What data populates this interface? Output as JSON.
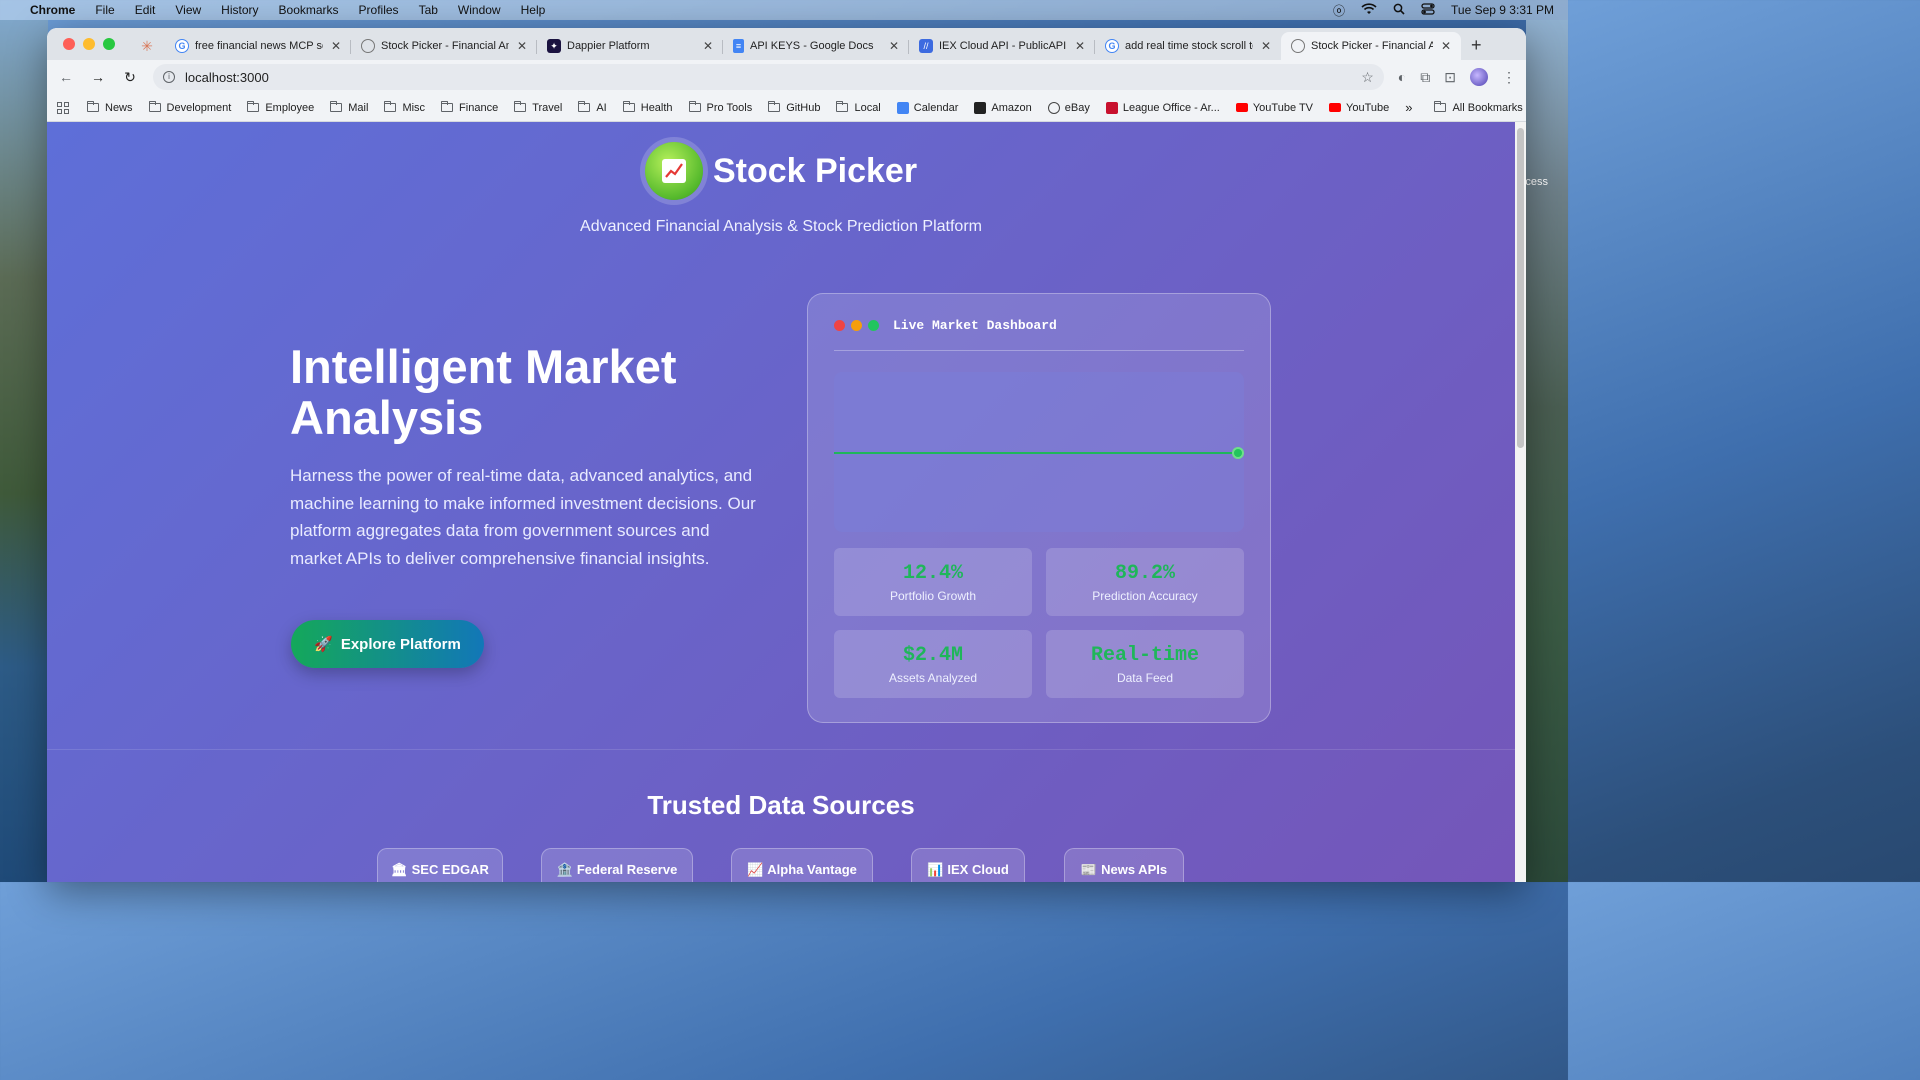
{
  "menubar": {
    "app": "Chrome",
    "items": [
      "File",
      "Edit",
      "View",
      "History",
      "Bookmarks",
      "Profiles",
      "Tab",
      "Window",
      "Help"
    ],
    "clock": "Tue Sep 9  3:31 PM"
  },
  "tabs": [
    {
      "title": "free financial news MCP ser",
      "favicon": "google-icon"
    },
    {
      "title": "Stock Picker - Financial Ana",
      "favicon": "globe-icon"
    },
    {
      "title": "Dappier Platform",
      "favicon": "dappier-icon"
    },
    {
      "title": "API KEYS - Google Docs",
      "favicon": "docs-icon"
    },
    {
      "title": "IEX Cloud API - PublicAPI",
      "favicon": "publicapi-icon"
    },
    {
      "title": "add real time stock scroll to",
      "favicon": "google-icon"
    },
    {
      "title": "Stock Picker - Financial Ana",
      "favicon": "globe-icon",
      "active": true
    }
  ],
  "address": {
    "url": "localhost:3000"
  },
  "bookmarks": {
    "items": [
      "News",
      "Development",
      "Employee",
      "Mail",
      "Misc",
      "Finance",
      "Travel",
      "AI",
      "Health",
      "Pro Tools",
      "GitHub",
      "Local"
    ],
    "special": [
      "Calendar",
      "Amazon",
      "eBay",
      "League Office - Ar...",
      "YouTube TV",
      "YouTube"
    ],
    "overflow": "»",
    "all": "All Bookmarks"
  },
  "brand": {
    "name": "Stock Picker",
    "subtitle": "Advanced Financial Analysis & Stock Prediction Platform",
    "logo_icon": "chart-emoji-icon"
  },
  "hero": {
    "heading": "Intelligent Market Analysis",
    "body": "Harness the power of real-time data, advanced analytics, and machine learning to make informed investment decisions. Our platform aggregates data from government sources and market APIs to deliver comprehensive financial insights.",
    "cta_icon": "🚀",
    "cta_label": "Explore Platform"
  },
  "dashboard": {
    "title": "Live Market Dashboard",
    "dot_colors": [
      "#ef4444",
      "#f59e0b",
      "#22c55e"
    ],
    "stats": [
      {
        "value": "12.4%",
        "label": "Portfolio Growth"
      },
      {
        "value": "89.2%",
        "label": "Prediction Accuracy"
      },
      {
        "value": "$2.4M",
        "label": "Assets Analyzed"
      },
      {
        "value": "Real-time",
        "label": "Data Feed"
      }
    ]
  },
  "sources": {
    "heading": "Trusted Data Sources",
    "items": [
      {
        "icon": "🏛",
        "label": "SEC EDGAR"
      },
      {
        "icon": "🏦",
        "label": "Federal Reserve"
      },
      {
        "icon": "📈",
        "label": "Alpha Vantage"
      },
      {
        "icon": "📊",
        "label": "IEX Cloud"
      },
      {
        "icon": "📰",
        "label": "News APIs"
      }
    ]
  },
  "colors": {
    "accent_green": "#1fb65a",
    "page_gradient_start": "#5e6fd8",
    "page_gradient_end": "#7456b9"
  },
  "desktop": {
    "peek_text": "cess"
  }
}
